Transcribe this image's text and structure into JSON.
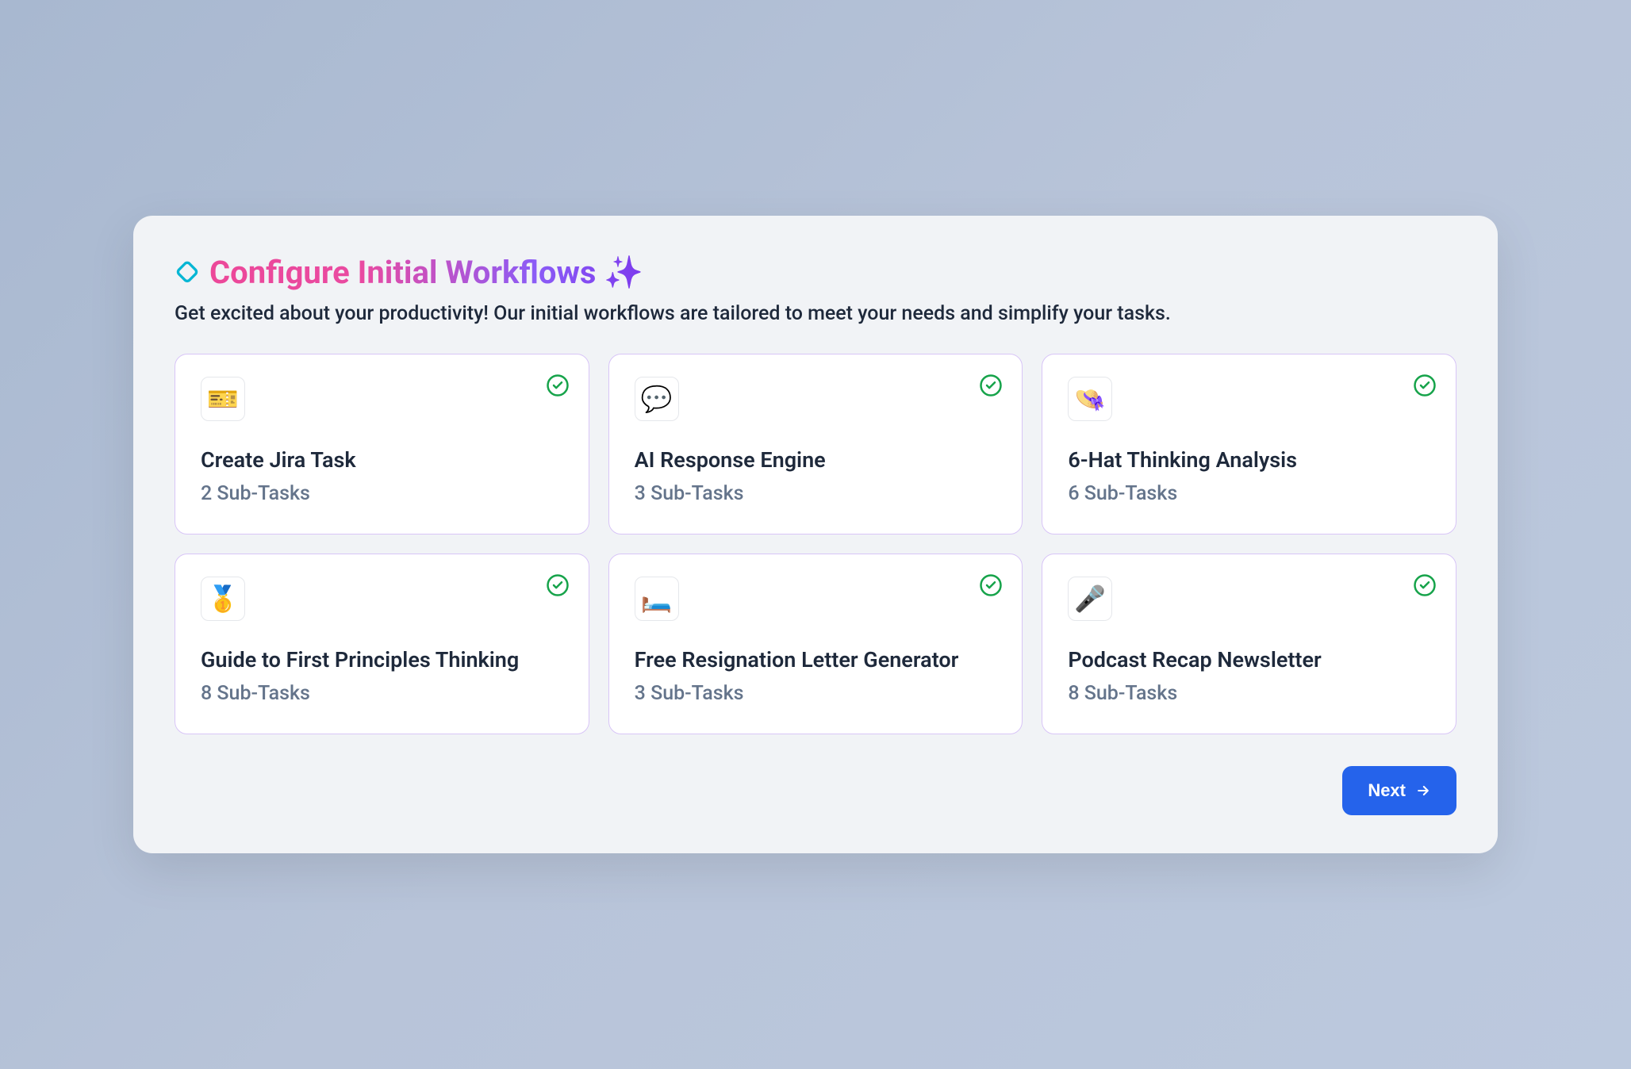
{
  "header": {
    "title": "Configure Initial Workflows ✨",
    "subtitle": "Get excited about your productivity! Our initial workflows are tailored to meet your needs and simplify your tasks."
  },
  "workflows": [
    {
      "icon": "🎫",
      "title": "Create Jira Task",
      "subtasks": "2 Sub-Tasks",
      "selected": true
    },
    {
      "icon": "💬",
      "title": "AI Response Engine",
      "subtasks": "3 Sub-Tasks",
      "selected": true
    },
    {
      "icon": "👒",
      "title": "6-Hat Thinking Analysis",
      "subtasks": "6 Sub-Tasks",
      "selected": true
    },
    {
      "icon": "🥇",
      "title": "Guide to First Principles Thinking",
      "subtasks": "8 Sub-Tasks",
      "selected": true
    },
    {
      "icon": "🛏️",
      "title": "Free Resignation Letter Generator",
      "subtasks": "3 Sub-Tasks",
      "selected": true
    },
    {
      "icon": "🎤",
      "title": "Podcast Recap Newsletter",
      "subtasks": "8 Sub-Tasks",
      "selected": true
    }
  ],
  "footer": {
    "next_label": "Next"
  }
}
